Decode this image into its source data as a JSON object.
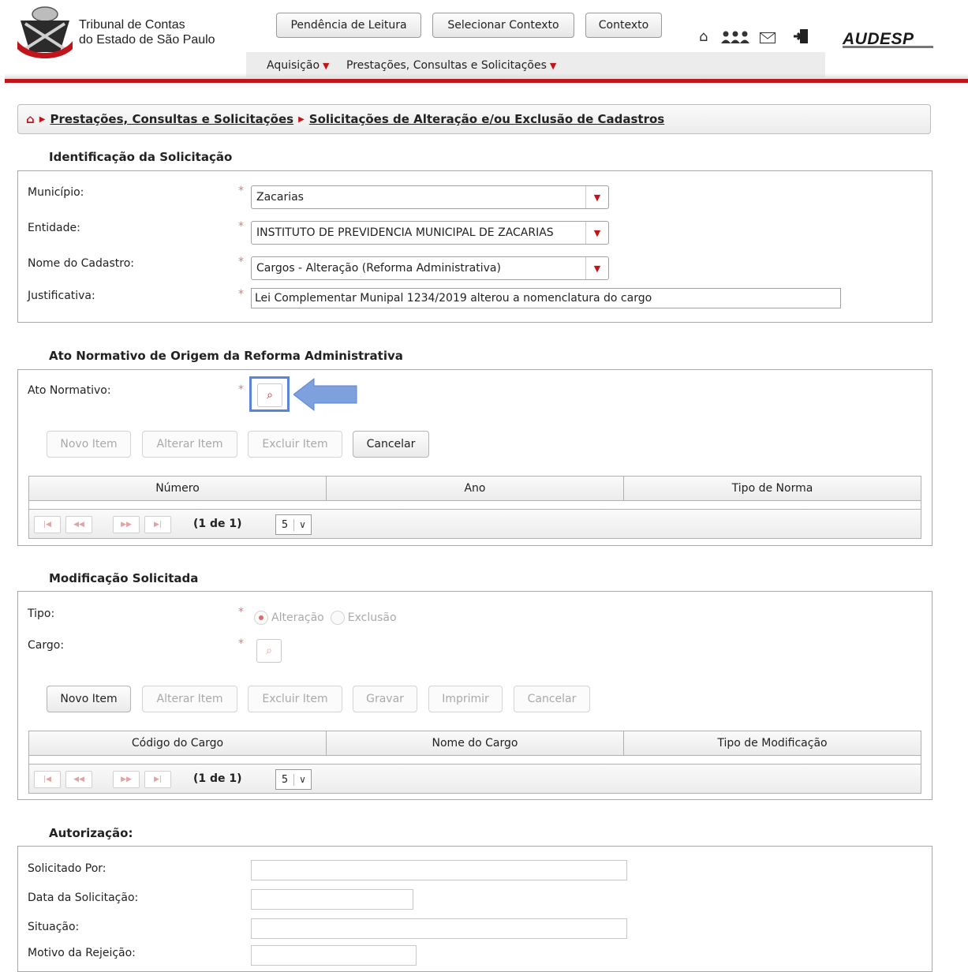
{
  "header": {
    "org_line1": "Tribunal de Contas",
    "org_line2": "do Estado de São Paulo",
    "buttons": [
      "Pendência de Leitura",
      "Selecionar Contexto",
      "Contexto"
    ],
    "brand": "AUDESP",
    "menu": [
      "Aquisição",
      "Prestações, Consultas e Solicitações"
    ],
    "icons": [
      "home-icon",
      "users-icon",
      "mail-icon",
      "logout-icon"
    ]
  },
  "breadcrumb": {
    "items": [
      "Prestações, Consultas e Solicitações",
      "Solicitações de Alteração e/ou Exclusão de Cadastros"
    ]
  },
  "identificacao": {
    "legend": "Identificação da Solicitação",
    "municipio_label": "Município:",
    "municipio_value": "Zacarias",
    "entidade_label": "Entidade:",
    "entidade_value": "INSTITUTO DE PREVIDENCIA MUNICIPAL DE ZACARIAS",
    "cadastro_label": "Nome do Cadastro:",
    "cadastro_value": "Cargos - Alteração (Reforma Administrativa)",
    "justificativa_label": "Justificativa:",
    "justificativa_value": "Lei Complementar Munipal 1234/2019 alterou a nomenclatura do cargo",
    "required_mark": "*"
  },
  "ato": {
    "legend": "Ato Normativo de Origem da Reforma Administrativa",
    "ato_label": "Ato Normativo:",
    "buttons": [
      "Novo Item",
      "Alterar Item",
      "Excluir Item",
      "Cancelar"
    ],
    "columns": [
      "Número",
      "Ano",
      "Tipo de Norma"
    ],
    "pager_text": "(1 de 1)",
    "page_size": "5"
  },
  "modificacao": {
    "legend": "Modificação Solicitada",
    "tipo_label": "Tipo:",
    "tipo_options": [
      "Alteração",
      "Exclusão"
    ],
    "cargo_label": "Cargo:",
    "buttons": [
      "Novo Item",
      "Alterar Item",
      "Excluir Item",
      "Gravar",
      "Imprimir",
      "Cancelar"
    ],
    "columns": [
      "Código do Cargo",
      "Nome do Cargo",
      "Tipo de Modificação"
    ],
    "pager_text": "(1 de 1)",
    "page_size": "5"
  },
  "autorizacao": {
    "legend": "Autorização:",
    "solicitado_label": "Solicitado Por:",
    "data_label": "Data da Solicitação:",
    "situacao_label": "Situação:",
    "motivo_label": "Motivo da Rejeição:"
  },
  "colors": {
    "accent_red": "#c0161b",
    "highlight_blue": "#5b84d6"
  }
}
